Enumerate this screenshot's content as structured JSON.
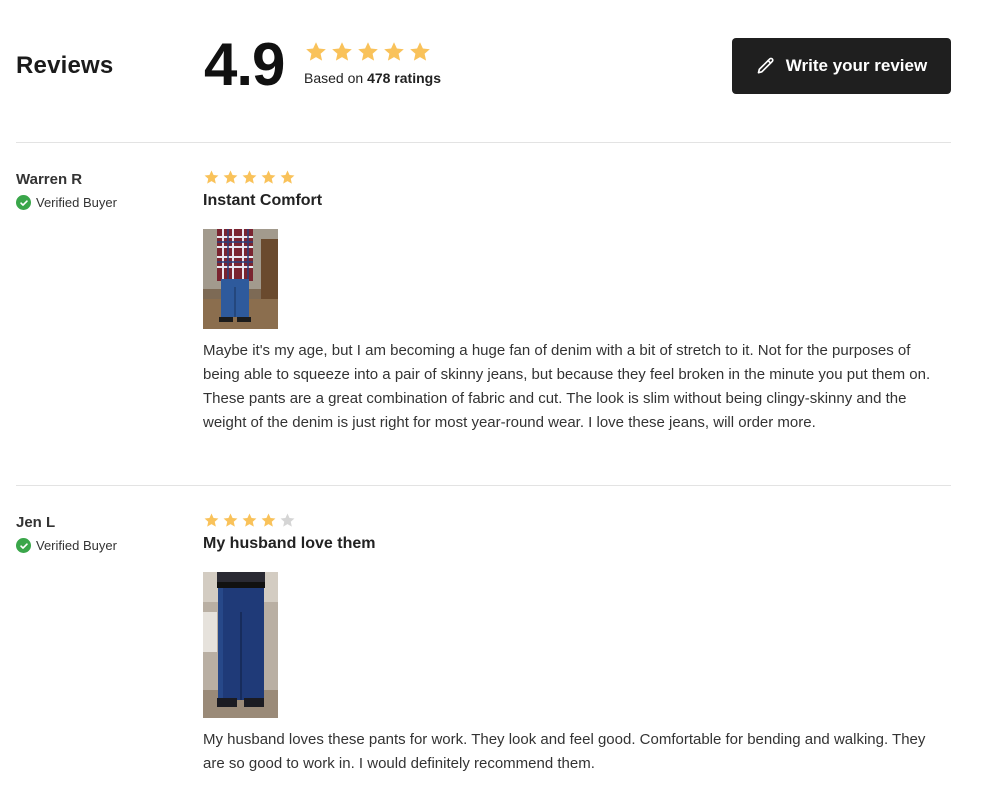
{
  "header": {
    "title": "Reviews",
    "average_rating": "4.9",
    "average_stars": 5,
    "based_prefix": "Based on",
    "ratings_count": "478 ratings",
    "write_button_label": "Write your review"
  },
  "colors": {
    "star_filled": "#f9c25a",
    "star_empty": "#d5d5d5",
    "verified_green": "#3aa64a",
    "button_bg": "#1f1f1f"
  },
  "reviews": [
    {
      "name": "Warren R",
      "verified_label": "Verified Buyer",
      "stars": 5,
      "title": "Instant Comfort",
      "text": "Maybe it's my age, but I am becoming a huge fan of denim with a bit of stretch to it. Not for the purposes of being able to squeeze into a pair of skinny jeans, but because they feel broken in the minute you put them on. These pants are a great combination of fabric and cut. The look is slim without being clingy-skinny and the weight of the denim is just right for most year-round wear. I love these jeans, will order more."
    },
    {
      "name": "Jen L",
      "verified_label": "Verified Buyer",
      "stars": 4,
      "title": "My husband love them",
      "text": "My husband loves these pants for work. They look and feel good. Comfortable for bending and walking. They are so good to work in. I would definitely recommend them."
    }
  ]
}
